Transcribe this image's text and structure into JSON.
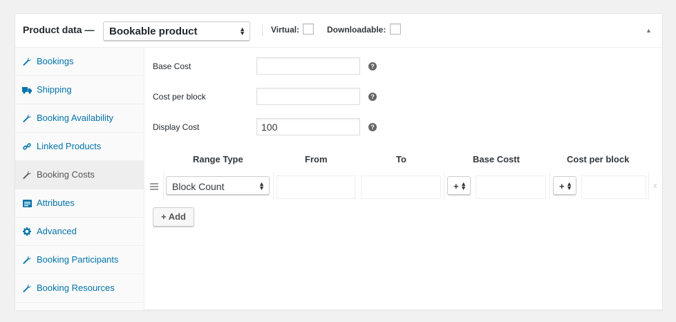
{
  "header": {
    "title": "Product data —",
    "product_type": "Bookable product",
    "virtual_label": "Virtual:",
    "downloadable_label": "Downloadable:",
    "virtual_checked": false,
    "downloadable_checked": false,
    "toggle_icon": "triangle-up-icon"
  },
  "sidebar": {
    "items": [
      {
        "label": "Bookings",
        "icon": "wrench-icon"
      },
      {
        "label": "Shipping",
        "icon": "truck-icon"
      },
      {
        "label": "Booking Availability",
        "icon": "wrench-icon"
      },
      {
        "label": "Linked Products",
        "icon": "link-icon"
      },
      {
        "label": "Booking Costs",
        "icon": "wrench-icon",
        "active": true
      },
      {
        "label": "Attributes",
        "icon": "list-icon"
      },
      {
        "label": "Advanced",
        "icon": "gear-icon"
      },
      {
        "label": "Booking Participants",
        "icon": "wrench-icon"
      },
      {
        "label": "Booking Resources",
        "icon": "wrench-icon"
      }
    ]
  },
  "fields": {
    "base_cost": {
      "label": "Base Cost",
      "value": ""
    },
    "cost_per_block": {
      "label": "Cost per block",
      "value": ""
    },
    "display_cost": {
      "label": "Display Cost",
      "value": "100"
    }
  },
  "table": {
    "headers": [
      "Range Type",
      "From",
      "To",
      "Base Costt",
      "Cost per block"
    ],
    "row": {
      "range_type": "Block Count",
      "from": "",
      "to": "",
      "base_modifier": "+",
      "base_cost": "",
      "block_modifier": "+",
      "block_cost": "",
      "remove": "x"
    },
    "add_button": "+ Add"
  },
  "colors": {
    "link": "#0073aa",
    "active_bg": "#eeeeee"
  }
}
